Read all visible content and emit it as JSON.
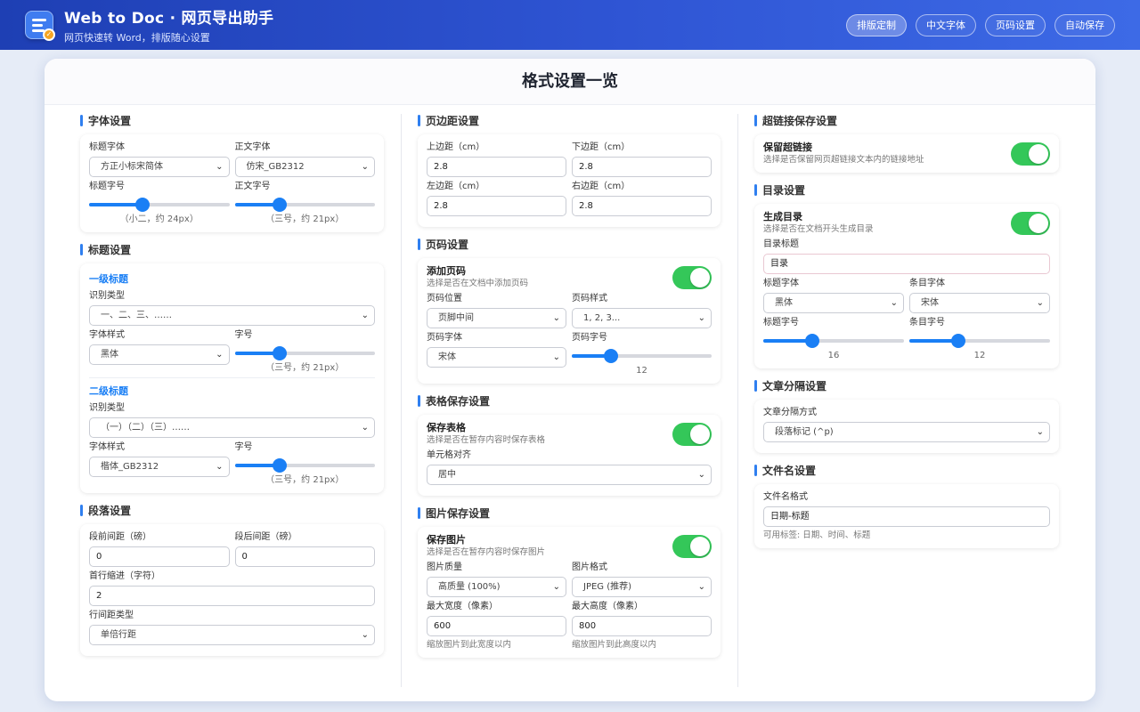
{
  "app": {
    "title": "Web to Doc · 网页导出助手",
    "subtitle": "网页快速转 Word，排版随心设置"
  },
  "nav": [
    "排版定制",
    "中文字体",
    "页码设置",
    "自动保存"
  ],
  "card_title": "格式设置一览",
  "font": {
    "header": "字体设置",
    "title_font_label": "标题字体",
    "title_font": "方正小标宋简体",
    "body_font_label": "正文字体",
    "body_font": "仿宋_GB2312",
    "title_size_label": "标题字号",
    "title_size_caption": "（小二，约 24px）",
    "title_size_fraction": 0.38,
    "body_size_label": "正文字号",
    "body_size_caption": "（三号，约 21px）",
    "body_size_fraction": 0.32
  },
  "heading": {
    "header": "标题设置",
    "l1_title": "一级标题",
    "l1_type_label": "识别类型",
    "l1_type": "一、二、三、……",
    "l1_style_label": "字体样式",
    "l1_style": "黑体",
    "l1_size_label": "字号",
    "l1_size_caption": "（三号，约 21px）",
    "l1_size_fraction": 0.32,
    "l2_title": "二级标题",
    "l2_type_label": "识别类型",
    "l2_type": "（一）（二）（三）……",
    "l2_style_label": "字体样式",
    "l2_style": "楷体_GB2312",
    "l2_size_label": "字号",
    "l2_size_caption": "（三号，约 21px）",
    "l2_size_fraction": 0.32
  },
  "paragraph": {
    "header": "段落设置",
    "before_label": "段前间距（磅）",
    "before": "0",
    "after_label": "段后间距（磅）",
    "after": "0",
    "indent_label": "首行缩进（字符）",
    "indent": "2",
    "line_label": "行间距类型",
    "line": "单倍行距"
  },
  "margin": {
    "header": "页边距设置",
    "top_label": "上边距（cm）",
    "top": "2.8",
    "bottom_label": "下边距（cm）",
    "bottom": "2.8",
    "left_label": "左边距（cm）",
    "left": "2.8",
    "right_label": "右边距（cm）",
    "right": "2.8"
  },
  "pagenum": {
    "header": "页码设置",
    "toggle_title": "添加页码",
    "toggle_desc": "选择是否在文档中添加页码",
    "enabled": true,
    "position_label": "页码位置",
    "position": "页脚中间",
    "style_label": "页码样式",
    "style": "1, 2, 3...",
    "font_label": "页码字体",
    "font": "宋体",
    "size_label": "页码字号",
    "size": "12",
    "size_fraction": 0.28
  },
  "table": {
    "header": "表格保存设置",
    "toggle_title": "保存表格",
    "toggle_desc": "选择是否在暂存内容时保存表格",
    "enabled": true,
    "align_label": "单元格对齐",
    "align": "居中"
  },
  "image": {
    "header": "图片保存设置",
    "toggle_title": "保存图片",
    "toggle_desc": "选择是否在暂存内容时保存图片",
    "enabled": true,
    "quality_label": "图片质量",
    "quality": "高质量 (100%)",
    "format_label": "图片格式",
    "format": "JPEG (推荐)",
    "maxw_label": "最大宽度（像素）",
    "maxw": "600",
    "maxw_hint": "缩放图片到此宽度以内",
    "maxh_label": "最大高度（像素）",
    "maxh": "800",
    "maxh_hint": "缩放图片到此高度以内"
  },
  "link": {
    "header": "超链接保存设置",
    "toggle_title": "保留超链接",
    "toggle_desc": "选择是否保留网页超链接文本内的链接地址",
    "enabled": true
  },
  "toc": {
    "header": "目录设置",
    "toggle_title": "生成目录",
    "toggle_desc": "选择是否在文档开头生成目录",
    "enabled": true,
    "title_label": "目录标题",
    "title": "目录",
    "title_font_label": "标题字体",
    "title_font": "黑体",
    "item_font_label": "条目字体",
    "item_font": "宋体",
    "title_size_label": "标题字号",
    "title_size": "16",
    "title_size_fraction": 0.35,
    "item_size_label": "条目字号",
    "item_size": "12",
    "item_size_fraction": 0.35
  },
  "separator": {
    "header": "文章分隔设置",
    "mode_label": "文章分隔方式",
    "mode": "段落标记 (^p)"
  },
  "filename": {
    "header": "文件名设置",
    "format_label": "文件名格式",
    "format": "日期-标题",
    "hint": "可用标签: 日期、时间、标题"
  },
  "colors": {
    "accent": "#1a7ff5",
    "toggle_on": "#34c759",
    "header_start": "#1e3fb4",
    "header_end": "#3d6ae6"
  },
  "icons": {
    "logo": "document-lines-icon",
    "select": "chevron-down-icon"
  }
}
